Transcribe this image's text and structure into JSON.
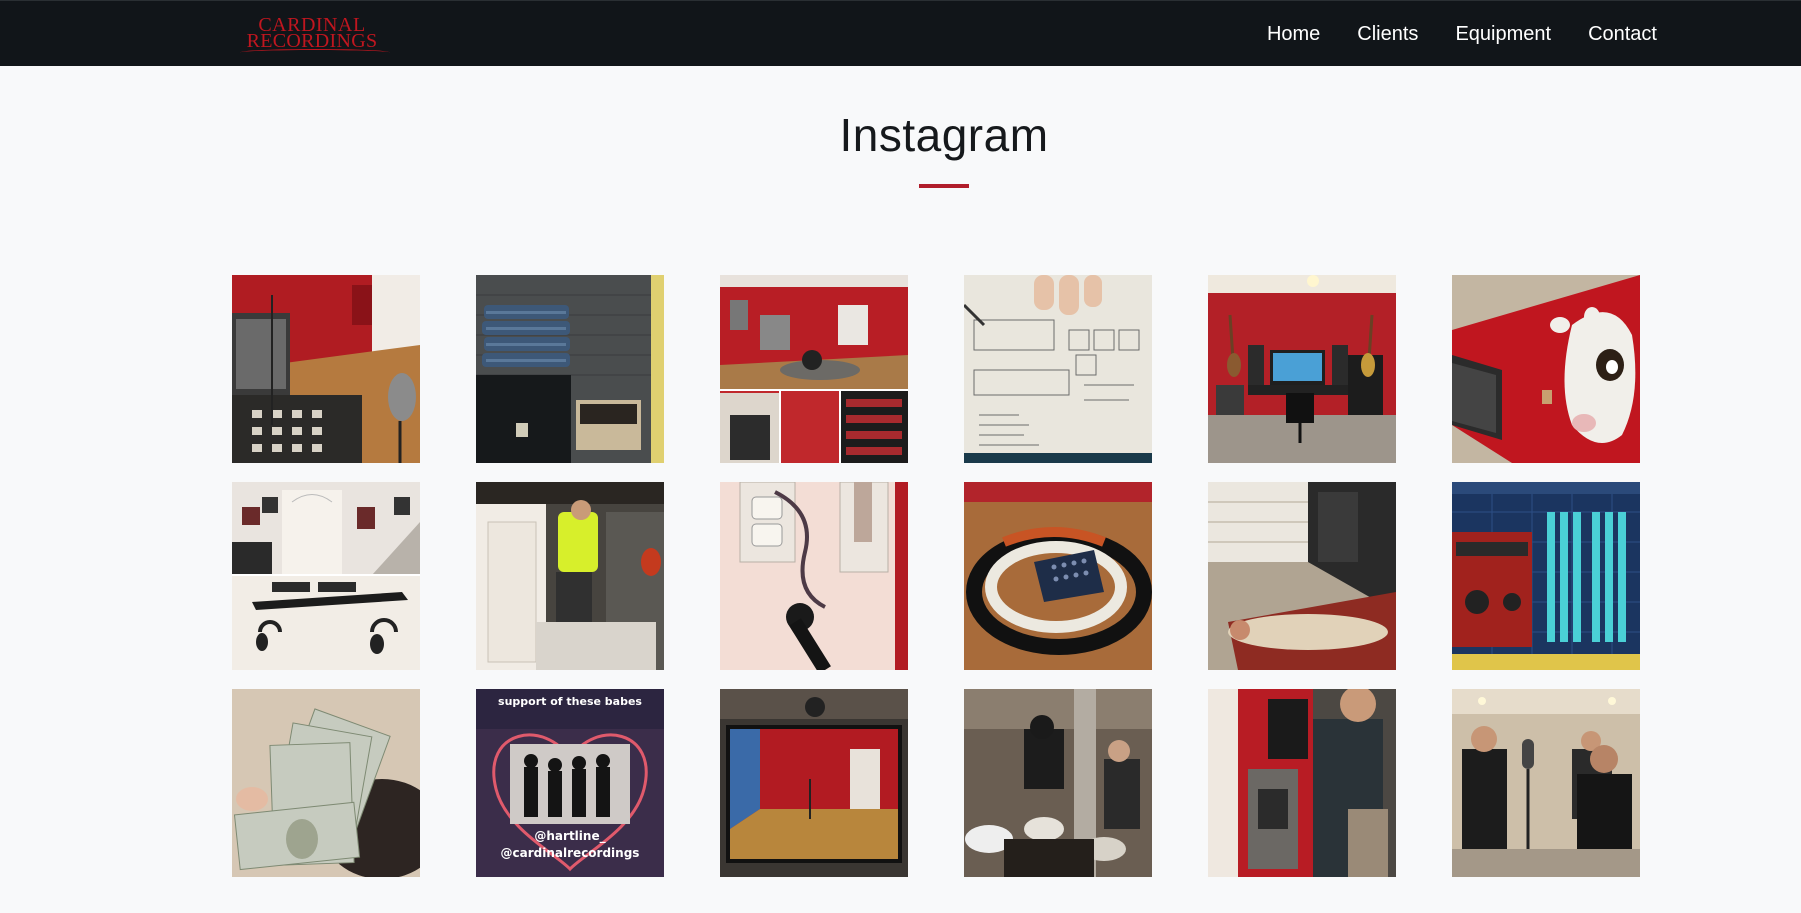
{
  "brand": {
    "line1": "CARDINAL",
    "line2": "RECORDINGS",
    "color": "#c0161f"
  },
  "nav": [
    {
      "label": "Home"
    },
    {
      "label": "Clients"
    },
    {
      "label": "Equipment"
    },
    {
      "label": "Contact"
    }
  ],
  "section": {
    "title": "Instagram",
    "accent": "#b11d2b"
  },
  "gallery": [
    {
      "name": "instagram-post-studio-amp-mic"
    },
    {
      "name": "instagram-post-foam-panels-case"
    },
    {
      "name": "instagram-post-studio-collage"
    },
    {
      "name": "instagram-post-notebook-plan"
    },
    {
      "name": "instagram-post-control-room"
    },
    {
      "name": "instagram-post-cow-head"
    },
    {
      "name": "instagram-post-entry-headphone-rack"
    },
    {
      "name": "instagram-post-worker-ceiling"
    },
    {
      "name": "instagram-post-wall-outlet"
    },
    {
      "name": "instagram-post-snake-cable"
    },
    {
      "name": "instagram-post-garage-floor"
    },
    {
      "name": "instagram-post-daw-plugin"
    },
    {
      "name": "instagram-post-cash"
    },
    {
      "name": "instagram-post-band-heart",
      "caption_top": "support of these babes",
      "caption_handle1": "@hartline_",
      "caption_handle2": "@cardinalrecordings"
    },
    {
      "name": "instagram-post-live-room-tv"
    },
    {
      "name": "instagram-post-drummer"
    },
    {
      "name": "instagram-post-mounting-panel"
    },
    {
      "name": "instagram-post-vocal-session"
    }
  ]
}
